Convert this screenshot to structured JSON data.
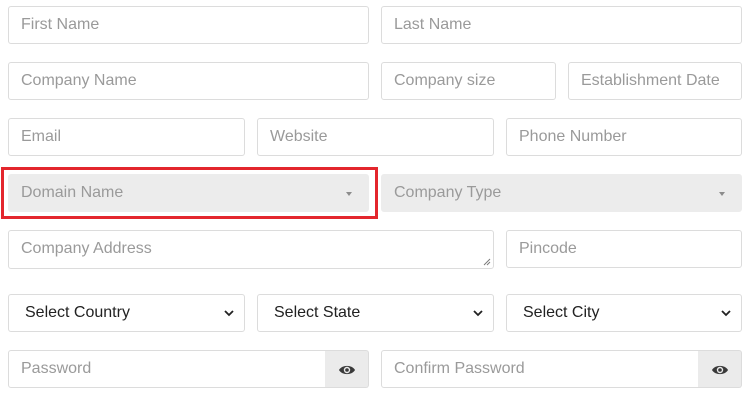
{
  "form": {
    "first_name": {
      "placeholder": "First Name"
    },
    "last_name": {
      "placeholder": "Last Name"
    },
    "company_name": {
      "placeholder": "Company Name"
    },
    "company_size": {
      "placeholder": "Company size"
    },
    "establishment_date": {
      "placeholder": "Establishment Date"
    },
    "email": {
      "placeholder": "Email"
    },
    "website": {
      "placeholder": "Website"
    },
    "phone_number": {
      "placeholder": "Phone Number"
    },
    "domain_name": {
      "placeholder": "Domain Name",
      "icon": "caret-down-icon"
    },
    "company_type": {
      "placeholder": "Company Type",
      "icon": "caret-down-icon"
    },
    "company_address": {
      "placeholder": "Company Address"
    },
    "pincode": {
      "placeholder": "Pincode"
    },
    "country": {
      "selected": "Select Country"
    },
    "state": {
      "selected": "Select State"
    },
    "city": {
      "selected": "Select City"
    },
    "password": {
      "placeholder": "Password",
      "toggle_icon": "eye-icon"
    },
    "confirm_password": {
      "placeholder": "Confirm Password",
      "toggle_icon": "eye-icon"
    }
  },
  "colors": {
    "highlight": "#e3262d",
    "border": "#dcdcdc",
    "disabled_bg": "#ececec",
    "placeholder_text": "#9a9a9a"
  }
}
